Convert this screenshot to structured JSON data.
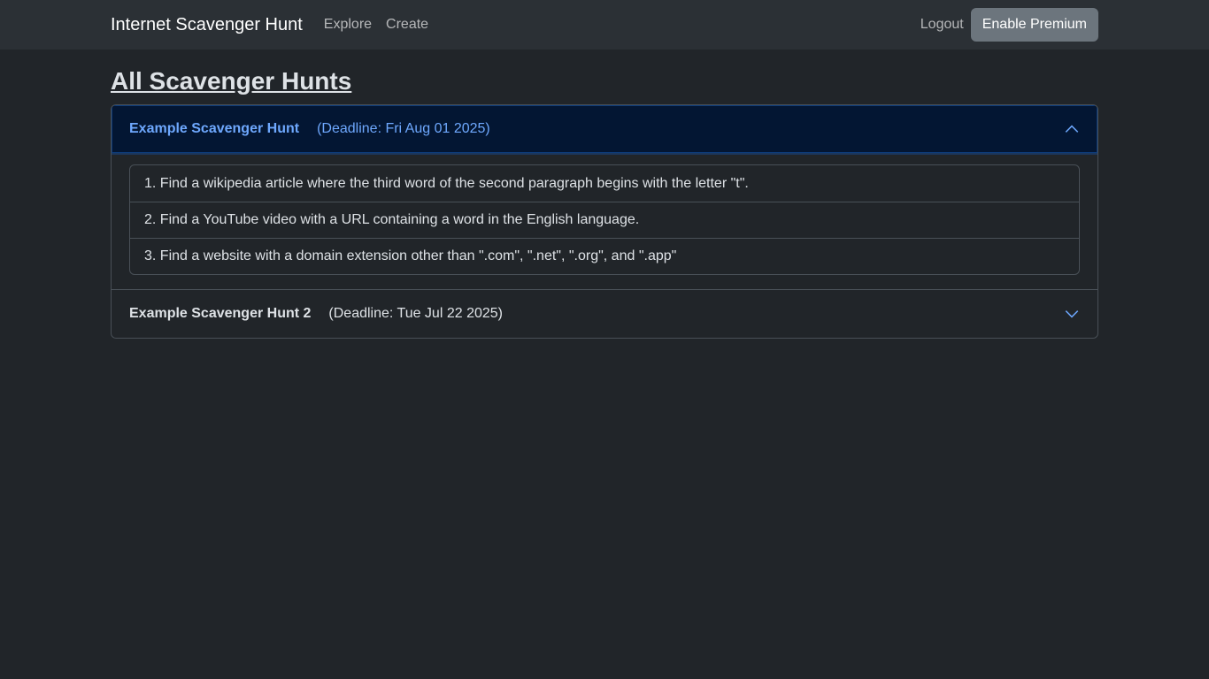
{
  "nav": {
    "brand": "Internet Scavenger Hunt",
    "links": [
      "Explore",
      "Create"
    ],
    "logout": "Logout",
    "premium": "Enable Premium"
  },
  "page": {
    "title": "All Scavenger Hunts"
  },
  "hunts": [
    {
      "title": "Example Scavenger Hunt",
      "deadline": "(Deadline: Fri Aug 01 2025)",
      "expanded": true,
      "items": [
        "1. Find a wikipedia article where the third word of the second paragraph begins with the letter \"t\".",
        "2. Find a YouTube video with a URL containing a word in the English language.",
        "3. Find a website with a domain extension other than \".com\", \".net\", \".org\", and \".app\""
      ]
    },
    {
      "title": "Example Scavenger Hunt 2",
      "deadline": "(Deadline: Tue Jul 22 2025)",
      "expanded": false
    }
  ],
  "colors": {
    "background": "#212529",
    "navbar": "#2b3035",
    "accent": "#6ea8fe",
    "active_header": "#031633",
    "button": "#6c757d"
  }
}
